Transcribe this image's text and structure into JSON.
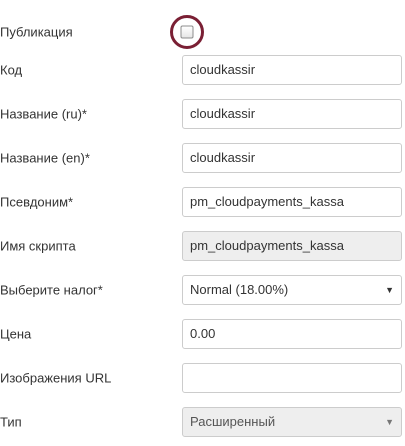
{
  "form": {
    "publish": {
      "label": "Публикация",
      "checked": false
    },
    "code": {
      "label": "Код",
      "value": "cloudkassir"
    },
    "name_ru": {
      "label": "Название (ru)*",
      "value": "cloudkassir"
    },
    "name_en": {
      "label": "Название (en)*",
      "value": "cloudkassir"
    },
    "alias": {
      "label": "Псевдоним*",
      "value": "pm_cloudpayments_kassa"
    },
    "script": {
      "label": "Имя скрипта",
      "value": "pm_cloudpayments_kassa"
    },
    "tax": {
      "label": "Выберите налог*",
      "value": "Normal (18.00%)"
    },
    "price": {
      "label": "Цена",
      "value": "0.00"
    },
    "image_url": {
      "label": "Изображения URL",
      "value": ""
    },
    "type": {
      "label": "Тип",
      "value": "Расширенный"
    }
  },
  "icons": {
    "dropdown": "caret-down-icon"
  },
  "colors": {
    "highlight_ring": "#7a1f34",
    "readonly_bg": "#eeeeee",
    "border": "#cccccc"
  }
}
